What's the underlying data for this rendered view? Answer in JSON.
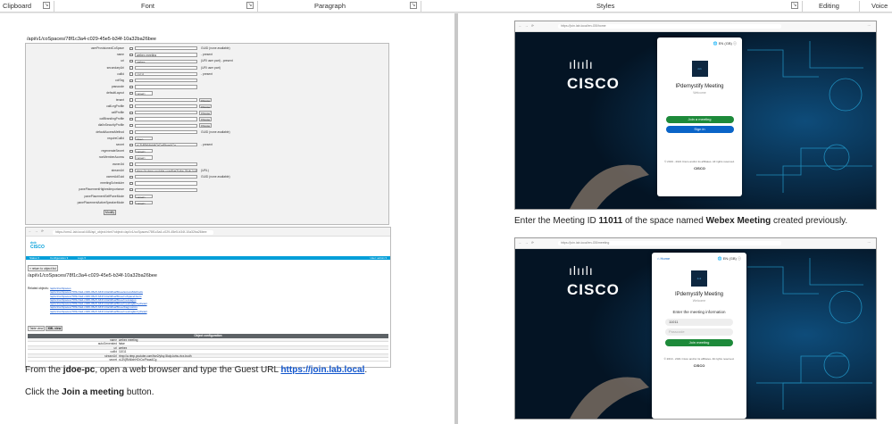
{
  "ribbon": {
    "groups": [
      "Clipboard",
      "Font",
      "Paragraph",
      "Styles",
      "Editing",
      "Voice"
    ]
  },
  "left": {
    "api_path": "/api/v1/coSpaces/78f1c3a4-c029-45e5-b34f-10a32ba26bee",
    "form_rows": [
      {
        "label": "userProvisionedCoSpace",
        "value": "",
        "note": "GUID (none available)"
      },
      {
        "label": "name",
        "value": "webex meeting",
        "note": "- present"
      },
      {
        "label": "uri",
        "value": "webex",
        "note": "(URI user part) - present"
      },
      {
        "label": "secondaryUri",
        "value": "",
        "note": "(URI user part)"
      },
      {
        "label": "callId",
        "value": "11011",
        "note": "- present"
      },
      {
        "label": "cdrTag",
        "value": "",
        "note": ""
      },
      {
        "label": "passcode",
        "value": "",
        "note": ""
      },
      {
        "label": "defaultLayout",
        "value": "<unset>",
        "note": ""
      },
      {
        "label": "tenant",
        "value": "",
        "note": "Choose"
      },
      {
        "label": "callLegProfile",
        "value": "",
        "note": "Choose"
      },
      {
        "label": "callProfile",
        "value": "",
        "note": "Choose"
      },
      {
        "label": "callBrandingProfile",
        "value": "",
        "note": "Choose"
      },
      {
        "label": "dialInSecurityProfile",
        "value": "",
        "note": "Choose"
      },
      {
        "label": "defaultAccessMethod",
        "value": "",
        "note": "GUID (none available)"
      },
      {
        "label": "requireCallId",
        "value": "<true>",
        "note": ""
      },
      {
        "label": "secret",
        "value": "xL3VjRkNlxhHOrCwPhoaACg",
        "note": "- present"
      },
      {
        "label": "regenerateSecret",
        "value": "<unset>",
        "note": ""
      },
      {
        "label": "nonMemberAccess",
        "value": "<unset>",
        "note": ""
      },
      {
        "label": "ownerJid",
        "value": "",
        "note": ""
      },
      {
        "label": "streamUrl",
        "value": "rtmp://a.rtmp.youtube.com/live2/yfoy-5kdp-kvbu-rtcx",
        "note": "(URL)"
      },
      {
        "label": "ownerAdGuid",
        "value": "",
        "note": "GUID (none available)"
      },
      {
        "label": "meetingScheduler",
        "value": "",
        "note": ""
      },
      {
        "label": "panePlacementHighestImportance",
        "value": "",
        "note": ""
      },
      {
        "label": "panePlacementSelfPaneMode",
        "value": "<unset>",
        "note": ""
      },
      {
        "label": "panePlacementActiveSpeakerMode",
        "value": "<unset>",
        "note": ""
      }
    ],
    "modify_label": "Modify",
    "browser_url": "https://cms1.lab.local:445/api_object.html?object=/api/v1/coSpaces/78f1c3a4-c029-45e5-b34f-10a32ba26bee",
    "cisco_brand": "CISCO",
    "nav": {
      "status": "Status ▾",
      "config": "Configuration ▾",
      "logs": "Logs ▾",
      "user": "User: admin ▾"
    },
    "return_btn": "« return to object list",
    "related_label": "Related objects:",
    "related_links": [
      "/api/v1/coSpaces",
      "/api/v1/coSpaces/78f1c3a4-c029-45e5-b34f-10a32ba26bee/accessMethods",
      "/api/v1/coSpaces/78f1c3a4-c029-45e5-b34f-10a32ba26bee/coSpaceUsers",
      "/api/v1/coSpaces/78f1c3a4-c029-45e5-b34f-10a32ba26bee/messages",
      "/api/v1/coSpaces/78f1c3a4-c029-45e5-b34f-10a32ba26bee/meetingEntryDetail",
      "/api/v1/coSpaces/78f1c3a4-c029-45e5-b34f-10a32ba26bee/diagnostics",
      "/api/v1/coSpaces/78f1c3a4-c029-45e5-b34f-10a32ba26bee/meetingEntryDetail"
    ],
    "view_tabs": [
      "Table view",
      "XML view"
    ],
    "obj_config_title": "Object configuration",
    "obj_rows": [
      {
        "k": "name",
        "v": "webex meeting"
      },
      {
        "k": "autoGenerated",
        "v": "false"
      },
      {
        "k": "uri",
        "v": "webex"
      },
      {
        "k": "callId",
        "v": "11011"
      },
      {
        "k": "streamUrl",
        "v": "rtmp://a.rtmp.youtube.com/live2/yfoy-5kdp-kvbu-rtcx-budh"
      },
      {
        "k": "secret",
        "v": "xL3VjRkNlxhHOrCwPhoaACg"
      }
    ],
    "para1_a": "From the ",
    "para1_b": "jdoe-pc",
    "para1_c": ", open a web browser and type the Guest URL ",
    "para1_link": "https://join.lab.local",
    "para1_d": ".",
    "para2_a": "Click the ",
    "para2_b": "Join a meeting",
    "para2_c": " button."
  },
  "right": {
    "url1": "https://join.lab.local/en-GB/home",
    "url2": "https://join.lab.local/en-GB/meeting",
    "cisco_word": "CISCO",
    "lang": "EN (GB)",
    "meeting_title": "IPdemystify Meeting",
    "welcome": "Welcome",
    "join_btn": "Join a meeting",
    "signin_btn": "Sign in",
    "copyright": "© 2019 - 2021 Cisco and/or its affiliates. All rights reserved.",
    "footer_brand": "CISCO",
    "para_a": "Enter the Meeting ID ",
    "para_b": "11011",
    "para_c": " of the space named ",
    "para_d": "Webex Meeting",
    "para_e": " created previously.",
    "home": "Home",
    "enter_info": "Enter the meeting information",
    "meeting_id": "11011",
    "passcode_ph": "Passcode",
    "join_meeting_btn": "Join meeting"
  }
}
